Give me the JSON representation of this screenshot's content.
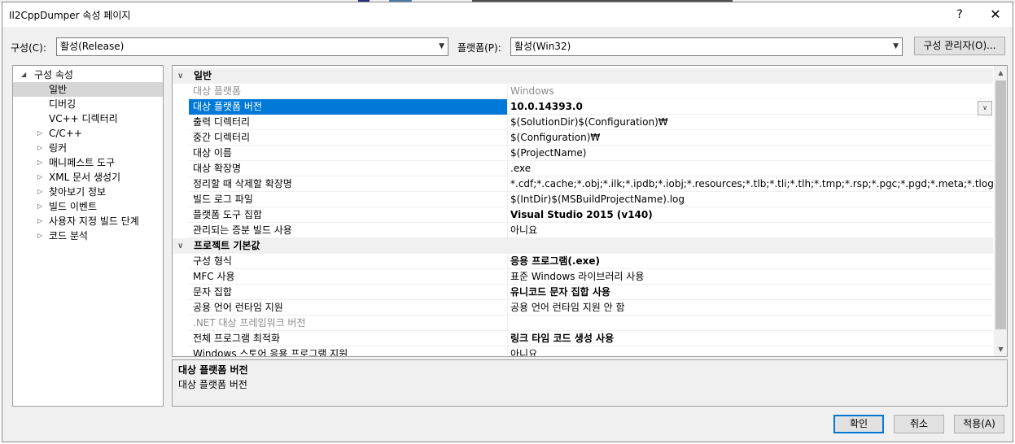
{
  "window": {
    "title": "Il2CppDumper 속성 페이지",
    "help_glyph": "?",
    "close_glyph": "✕"
  },
  "config_bar": {
    "config_label": "구성(C):",
    "config_value": "활성(Release)",
    "platform_label": "플랫폼(P):",
    "platform_value": "활성(Win32)",
    "manager_button": "구성 관리자(O)..."
  },
  "tree": {
    "root": "구성 속성",
    "items": [
      {
        "label": "일반",
        "selected": true,
        "expandable": false
      },
      {
        "label": "디버깅",
        "expandable": false
      },
      {
        "label": "VC++ 디렉터리",
        "expandable": false
      },
      {
        "label": "C/C++",
        "expandable": true
      },
      {
        "label": "링커",
        "expandable": true
      },
      {
        "label": "매니페스트 도구",
        "expandable": true
      },
      {
        "label": "XML 문서 생성기",
        "expandable": true
      },
      {
        "label": "찾아보기 정보",
        "expandable": true
      },
      {
        "label": "빌드 이벤트",
        "expandable": true
      },
      {
        "label": "사용자 지정 빌드 단계",
        "expandable": true
      },
      {
        "label": "코드 분석",
        "expandable": true
      }
    ]
  },
  "grid": {
    "categories": [
      {
        "title": "일반",
        "rows": [
          {
            "name": "대상 플랫폼",
            "value": "Windows",
            "gray": true
          },
          {
            "name": "대상 플랫폼 버전",
            "value": "10.0.14393.0",
            "bold": true,
            "selected": true
          },
          {
            "name": "출력 디렉터리",
            "value": "$(SolutionDir)$(Configuration)₩"
          },
          {
            "name": "중간 디렉터리",
            "value": "$(Configuration)₩"
          },
          {
            "name": "대상 이름",
            "value": "$(ProjectName)"
          },
          {
            "name": "대상 확장명",
            "value": ".exe"
          },
          {
            "name": "정리할 때 삭제할 확장명",
            "value": "*.cdf;*.cache;*.obj;*.ilk;*.ipdb;*.iobj;*.resources;*.tlb;*.tli;*.tlh;*.tmp;*.rsp;*.pgc;*.pgd;*.meta;*.tlog;*.manifest;*.res"
          },
          {
            "name": "빌드 로그 파일",
            "value": "$(IntDir)$(MSBuildProjectName).log"
          },
          {
            "name": "플랫폼 도구 집합",
            "value": "Visual Studio 2015 (v140)",
            "bold": true
          },
          {
            "name": "관리되는 증분 빌드 사용",
            "value": "아니요"
          }
        ]
      },
      {
        "title": "프로젝트 기본값",
        "rows": [
          {
            "name": "구성 형식",
            "value": "응용 프로그램(.exe)",
            "bold": true
          },
          {
            "name": "MFC 사용",
            "value": "표준 Windows 라이브러리 사용"
          },
          {
            "name": "문자 집합",
            "value": "유니코드 문자 집합 사용",
            "bold": true
          },
          {
            "name": "공용 언어 런타임 지원",
            "value": "공용 언어 런타임 지원 안 함"
          },
          {
            "name": ".NET 대상 프레임워크 버전",
            "value": "",
            "gray": true
          },
          {
            "name": "전체 프로그램 최적화",
            "value": "링크 타임 코드 생성 사용",
            "bold": true
          },
          {
            "name": "Windows 스토어 응용 프로그램 지원",
            "value": "아니요"
          }
        ]
      }
    ]
  },
  "description": {
    "title": "대상 플랫폼 버전",
    "text": "대상 플랫폼 버전"
  },
  "buttons": {
    "ok": "확인",
    "cancel": "취소",
    "apply": "적용(A)"
  }
}
